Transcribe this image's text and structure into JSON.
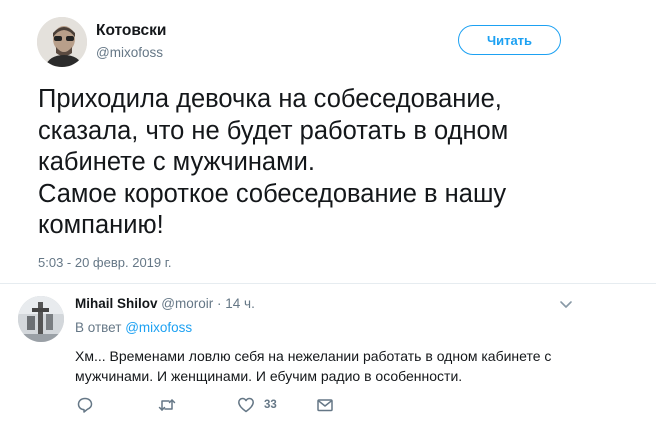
{
  "tweet": {
    "author_name": "Котовски",
    "author_handle": "@mixofoss",
    "follow_label": "Читать",
    "text_lines": [
      "Приходила девочка на собеседование,",
      "сказала, что не будет работать в одном",
      "кабинете с мужчинами.",
      "Самое короткое собеседование в нашу",
      "компанию!"
    ],
    "timestamp": "5:03 - 20 февр. 2019 г."
  },
  "reply": {
    "author_name": "Mihail Shilov",
    "author_handle": "@moroir",
    "separator": "·",
    "time_ago": "14 ч.",
    "reply_to_prefix": "В ответ",
    "reply_to_handle": "@mixofoss",
    "text_lines": [
      "Хм... Временами ловлю себя на нежелании работать в одном кабинете с",
      "мужчинами. И женщинами. И ебучим радио в особенности."
    ],
    "actions": {
      "reply_icon": "speech-bubble-icon",
      "retweet_icon": "retweet-icon",
      "like_icon": "heart-icon",
      "like_count": "33",
      "dm_icon": "envelope-icon"
    }
  },
  "colors": {
    "accent": "#1da1f2",
    "secondary_text": "#657786",
    "primary_text": "#14171a",
    "divider": "#e6ecf0"
  }
}
